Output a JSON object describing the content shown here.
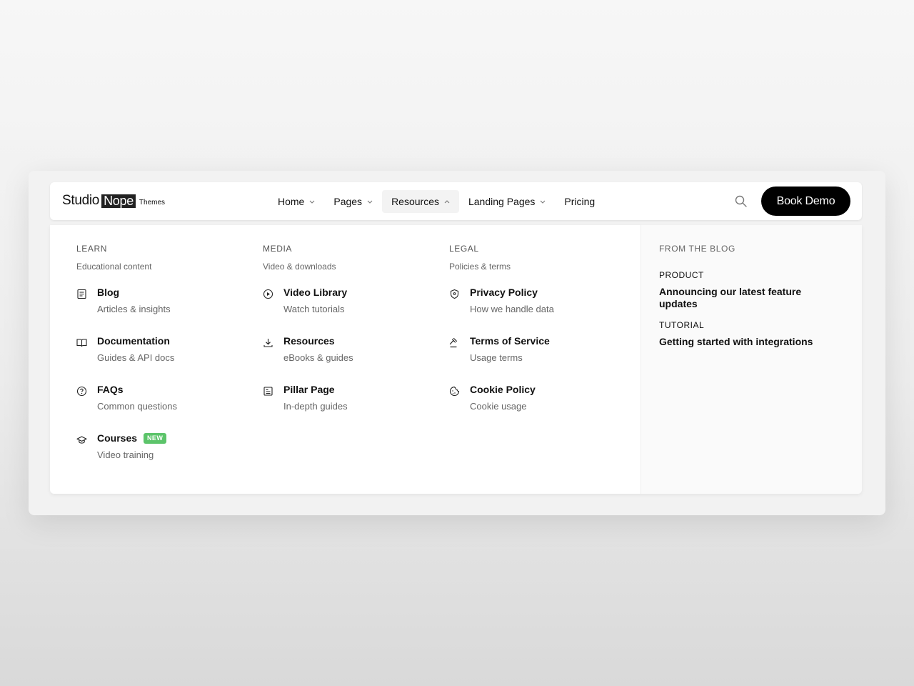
{
  "brand": {
    "studio": "Studio",
    "nope": "Nope",
    "themes": "Themes"
  },
  "nav": {
    "items": [
      {
        "label": "Home",
        "has_dropdown": true,
        "active": false
      },
      {
        "label": "Pages",
        "has_dropdown": true,
        "active": false
      },
      {
        "label": "Resources",
        "has_dropdown": true,
        "active": true
      },
      {
        "label": "Landing Pages",
        "has_dropdown": true,
        "active": false
      },
      {
        "label": "Pricing",
        "has_dropdown": false,
        "active": false
      }
    ],
    "search_icon": "search-icon",
    "cta_label": "Book Demo"
  },
  "menu": {
    "columns": [
      {
        "heading": "LEARN",
        "subheading": "Educational content",
        "items": [
          {
            "icon": "document-icon",
            "title": "Blog",
            "subtitle": "Articles & insights"
          },
          {
            "icon": "book-icon",
            "title": "Documentation",
            "subtitle": "Guides & API docs"
          },
          {
            "icon": "question-icon",
            "title": "FAQs",
            "subtitle": "Common questions"
          },
          {
            "icon": "graduation-cap-icon",
            "title": "Courses",
            "subtitle": "Video training",
            "badge": "NEW"
          }
        ]
      },
      {
        "heading": "MEDIA",
        "subheading": "Video & downloads",
        "items": [
          {
            "icon": "play-circle-icon",
            "title": "Video Library",
            "subtitle": "Watch tutorials"
          },
          {
            "icon": "download-icon",
            "title": "Resources",
            "subtitle": "eBooks & guides"
          },
          {
            "icon": "page-icon",
            "title": "Pillar Page",
            "subtitle": "In-depth guides"
          }
        ]
      },
      {
        "heading": "LEGAL",
        "subheading": "Policies & terms",
        "items": [
          {
            "icon": "shield-icon",
            "title": "Privacy Policy",
            "subtitle": "How we handle data"
          },
          {
            "icon": "gavel-icon",
            "title": "Terms of Service",
            "subtitle": "Usage terms"
          },
          {
            "icon": "cookie-icon",
            "title": "Cookie Policy",
            "subtitle": "Cookie usage"
          }
        ]
      }
    ],
    "blog": {
      "heading": "FROM THE BLOG",
      "posts": [
        {
          "category": "PRODUCT",
          "title": "Announcing our latest feature updates"
        },
        {
          "category": "TUTORIAL",
          "title": "Getting started with integrations"
        }
      ]
    }
  },
  "colors": {
    "badge": "#5cc46a",
    "cta_bg": "#000000",
    "active_nav_bg": "#f3f3f3"
  }
}
